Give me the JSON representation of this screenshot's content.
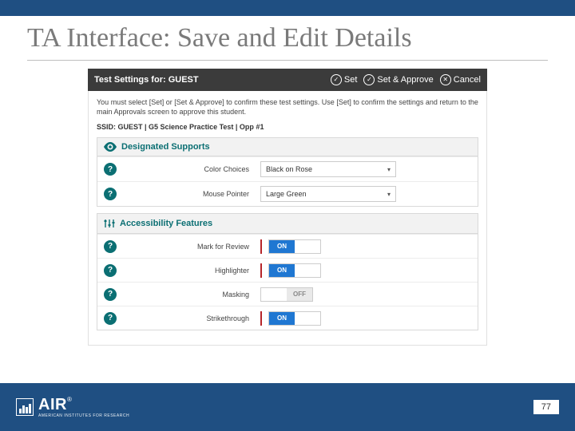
{
  "slide": {
    "title": "TA Interface: Save and Edit Details",
    "page_number": "77"
  },
  "panel": {
    "header_label": "Test Settings for: GUEST",
    "set_label": "Set",
    "set_approve_label": "Set & Approve",
    "cancel_label": "Cancel",
    "instructions": "You must select [Set] or [Set & Approve] to confirm these test settings. Use [Set] to confirm the settings and return to the main Approvals screen to approve this student.",
    "ssid_line": "SSID: GUEST | G5 Science Practice Test | Opp #1"
  },
  "designated": {
    "heading": "Designated Supports",
    "rows": [
      {
        "label": "Color Choices",
        "value": "Black on Rose"
      },
      {
        "label": "Mouse Pointer",
        "value": "Large Green"
      }
    ]
  },
  "accessibility": {
    "heading": "Accessibility Features",
    "rows": [
      {
        "label": "Mark for Review",
        "state": "ON"
      },
      {
        "label": "Highlighter",
        "state": "ON"
      },
      {
        "label": "Masking",
        "state": "OFF"
      },
      {
        "label": "Strikethrough",
        "state": "ON"
      }
    ]
  },
  "toggle_text": {
    "on": "ON",
    "off": "OFF"
  },
  "logo": {
    "text": "AIR",
    "tm": "®",
    "sub": "AMERICAN INSTITUTES FOR RESEARCH"
  }
}
